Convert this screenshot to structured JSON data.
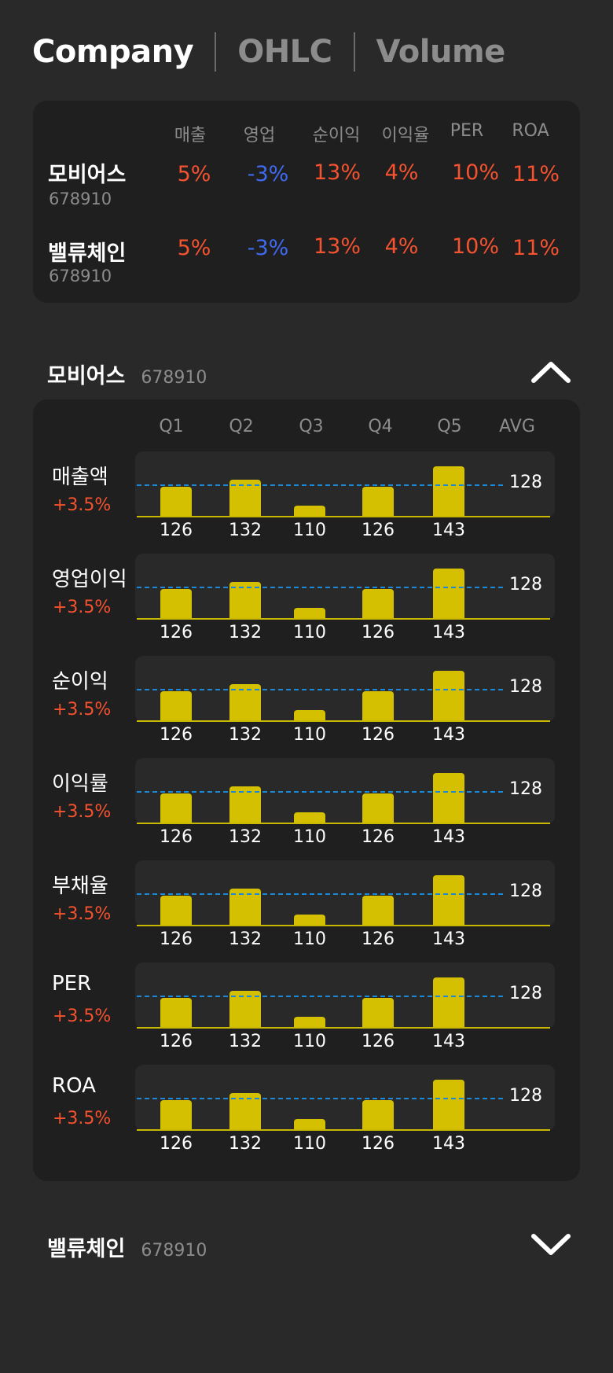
{
  "tabs": [
    {
      "label": "Company",
      "active": true
    },
    {
      "label": "OHLC",
      "active": false
    },
    {
      "label": "Volume",
      "active": false
    }
  ],
  "summary": {
    "headers": [
      "매출",
      "영업",
      "순이익",
      "이익율",
      "PER",
      "ROA"
    ],
    "rows": [
      {
        "name": "모비어스",
        "code": "678910",
        "values": [
          "5%",
          "-3%",
          "13%",
          "4%",
          "10%",
          "11%"
        ]
      },
      {
        "name": "밸류체인",
        "code": "678910",
        "values": [
          "5%",
          "-3%",
          "13%",
          "4%",
          "10%",
          "11%"
        ]
      }
    ]
  },
  "sections": [
    {
      "name": "모비어스",
      "code": "678910",
      "expanded": true,
      "icon": "chevron-up-icon"
    },
    {
      "name": "밸류체인",
      "code": "678910",
      "expanded": false,
      "icon": "chevron-down-icon"
    }
  ],
  "detail": {
    "columns": [
      "Q1",
      "Q2",
      "Q3",
      "Q4",
      "Q5",
      "AVG"
    ],
    "metrics": [
      {
        "label": "매출액",
        "change": "+3.5%",
        "values": [
          126,
          132,
          110,
          126,
          143
        ],
        "avg": "128"
      },
      {
        "label": "영업이익",
        "change": "+3.5%",
        "values": [
          126,
          132,
          110,
          126,
          143
        ],
        "avg": "128"
      },
      {
        "label": "순이익",
        "change": "+3.5%",
        "values": [
          126,
          132,
          110,
          126,
          143
        ],
        "avg": "128"
      },
      {
        "label": "이익률",
        "change": "+3.5%",
        "values": [
          126,
          132,
          110,
          126,
          143
        ],
        "avg": "128"
      },
      {
        "label": "부채율",
        "change": "+3.5%",
        "values": [
          126,
          132,
          110,
          126,
          143
        ],
        "avg": "128"
      },
      {
        "label": "PER",
        "change": "+3.5%",
        "values": [
          126,
          132,
          110,
          126,
          143
        ],
        "avg": "128"
      },
      {
        "label": "ROA",
        "change": "+3.5%",
        "values": [
          126,
          132,
          110,
          126,
          143
        ],
        "avg": "128"
      }
    ]
  },
  "colors": {
    "positive": "#f5522f",
    "negative": "#3e6af0",
    "bar": "#d4c000",
    "avg_line": "#1e88d8"
  }
}
